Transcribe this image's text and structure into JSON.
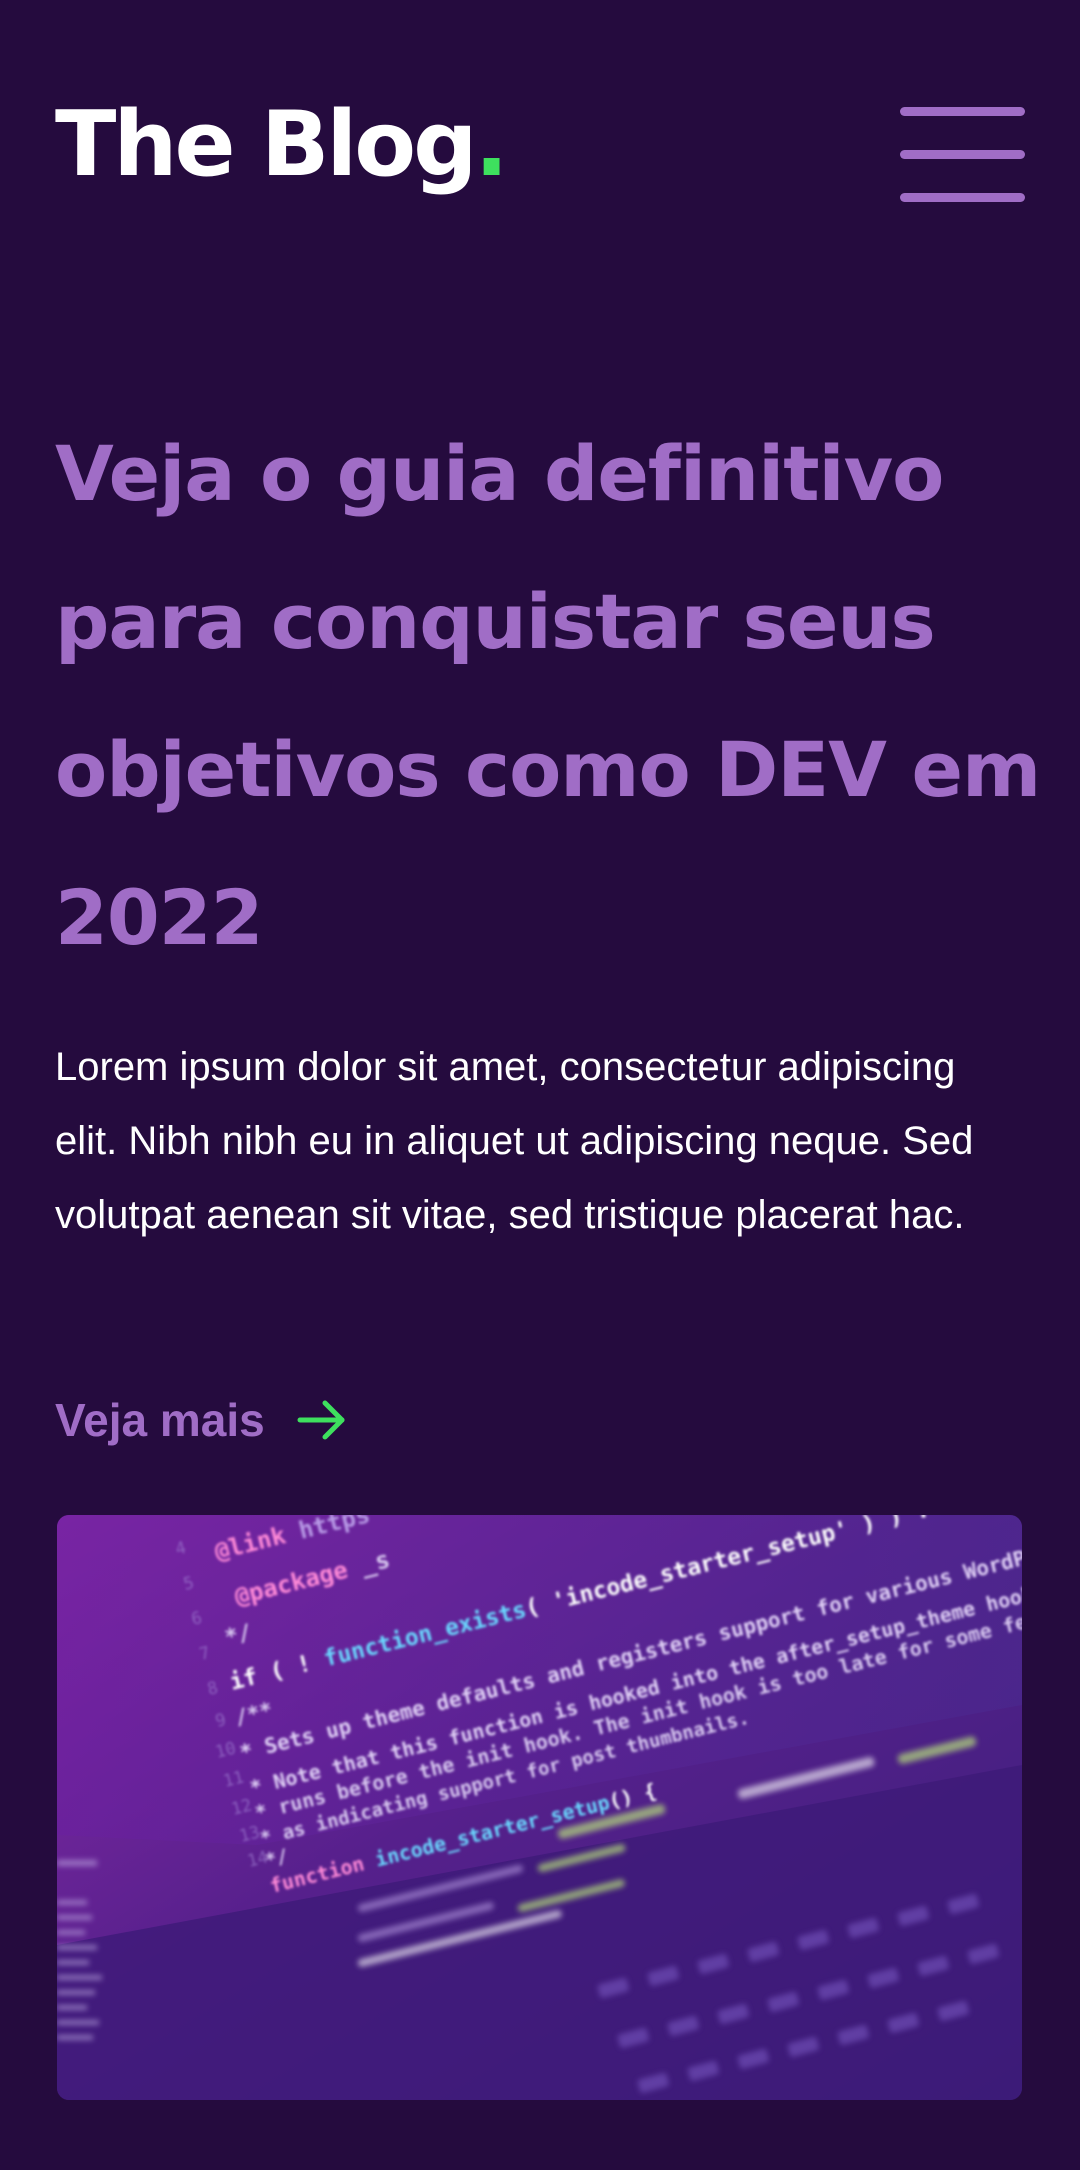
{
  "header": {
    "logo_text": "The Blog",
    "logo_dot": ".",
    "menu_icon": "hamburger-menu-icon"
  },
  "hero": {
    "title": "Veja o guia definitivo para conquistar seus objetivos como DEV em 2022",
    "description": "Lorem ipsum dolor sit amet, consectetur adipiscing elit. Nibh nibh eu in aliquet ut adipiscing neque. Sed volutpat aenean sit vitae, sed tristique placerat hac.",
    "link_label": "Veja mais",
    "link_icon": "arrow-right-icon"
  },
  "image": {
    "subject": "laptop-code-screen",
    "code_lines": [
      "@link https",
      "@package _s",
      "*/",
      "if ( ! function_exists( 'incode_starter_setup' ) ) :",
      "/**",
      " * Sets up theme defaults and registers support for various WordPress",
      " * Note that this function is hooked into the after_setup_theme hook,",
      " * runs before the init hook. The init hook is too late for some features",
      " * as indicating support for post thumbnails.",
      " */",
      "function incode_starter_setup() {"
    ]
  },
  "colors": {
    "background": "#250b3e",
    "accent_purple": "#a06dc6",
    "accent_green": "#3ee05e",
    "text_white": "#ffffff"
  }
}
